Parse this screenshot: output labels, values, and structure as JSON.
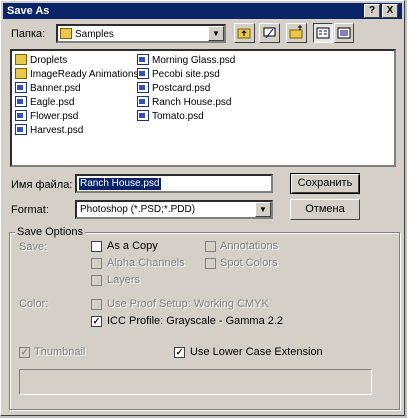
{
  "title": "Save As",
  "title_buttons": {
    "help": "?",
    "close": "X"
  },
  "look_in": {
    "label": "Папка:",
    "value": "Samples",
    "icon": "folder-icon"
  },
  "toolbar": [
    {
      "name": "up-folder-button",
      "icon": "up-folder-icon"
    },
    {
      "name": "desktop-button",
      "icon": "desktop-icon"
    },
    {
      "name": "new-folder-button",
      "icon": "new-folder-icon"
    },
    {
      "name": "list-view-button",
      "icon": "list-view-icon"
    },
    {
      "name": "details-view-button",
      "icon": "details-view-icon"
    }
  ],
  "files": [
    {
      "label": "Droplets",
      "type": "folder"
    },
    {
      "label": "ImageReady Animations",
      "type": "folder"
    },
    {
      "label": "Banner.psd",
      "type": "psd"
    },
    {
      "label": "Eagle.psd",
      "type": "psd"
    },
    {
      "label": "Flower.psd",
      "type": "psd"
    },
    {
      "label": "Harvest.psd",
      "type": "psd"
    },
    {
      "label": "Morning Glass.psd",
      "type": "psd"
    },
    {
      "label": "Pecobi site.psd",
      "type": "psd"
    },
    {
      "label": "Postcard.psd",
      "type": "psd"
    },
    {
      "label": "Ranch House.psd",
      "type": "psd"
    },
    {
      "label": "Tomato.psd",
      "type": "psd"
    }
  ],
  "filename": {
    "label": "Имя файла:",
    "value": "Ranch House.psd"
  },
  "format": {
    "label": "Format:",
    "value": "Photoshop (*.PSD;*.PDD)"
  },
  "buttons": {
    "save": "Сохранить",
    "cancel": "Отмена"
  },
  "save_options": {
    "group_label": "Save Options",
    "save_label": "Save:",
    "color_label": "Color:",
    "as_copy": "As a Copy",
    "alpha_channels": "Alpha Channels",
    "layers": "Layers",
    "annotations": "Annotations",
    "spot_colors": "Spot Colors",
    "use_proof": "Use Proof Setup:  Working CMYK",
    "icc_profile": "ICC Profile:  Grayscale - Gamma 2.2"
  },
  "thumbnail": "Thumbnail",
  "lower_case": "Use Lower Case Extension"
}
